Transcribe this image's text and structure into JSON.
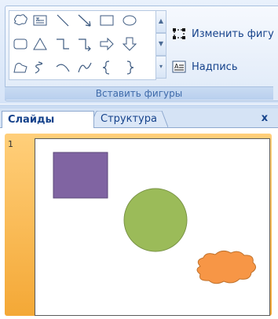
{
  "ribbon": {
    "group_title": "Вставить фигуры",
    "edit_shape_label": "Изменить фигу",
    "textbox_label": "Надпись",
    "gallery_shapes": [
      [
        "callout-cloud-icon",
        "textbox-icon",
        "line-icon",
        "arrow-line-icon",
        "rectangle-icon",
        "oval-icon"
      ],
      [
        "rounded-rectangle-icon",
        "triangle-icon",
        "elbow-connector-icon",
        "elbow-arrow-connector-icon",
        "right-arrow-icon",
        "down-arrow-icon"
      ],
      [
        "freeform-icon",
        "scribble-icon",
        "arc-icon",
        "curve-icon",
        "left-brace-icon",
        "right-brace-icon"
      ]
    ]
  },
  "pane": {
    "tab_slides": "Слайды",
    "tab_outline": "Структура",
    "close_label": "x"
  },
  "slide": {
    "number": "1",
    "colors": {
      "square": "#8064a2",
      "circle": "#9bbb59",
      "cloud": "#f79646"
    }
  }
}
